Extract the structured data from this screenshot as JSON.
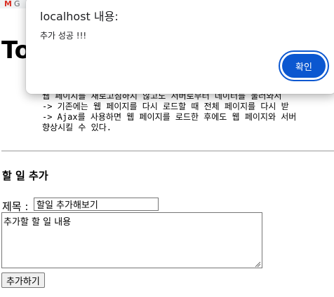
{
  "browser": {
    "tab_label": "G"
  },
  "page": {
    "title_partial": "To",
    "lines": [
      "웹 페이지를 새로고침하지 않고도 서버로부터 데이터를 불러와서",
      "-> 기존에는 웹 페이지를 다시 로드할 때 전체 페이지를 다시 받",
      "-> Ajax를 사용하면 웹 페이지를 로드한 후에도 웹 페이지와 서버",
      "향상시킬 수 있다."
    ],
    "section_heading": "할 일 추가",
    "form": {
      "title_label": "제목 :",
      "title_value": "할일 추가해보기",
      "content_value": "추가할 할 일 내용",
      "submit_label": "추가하기"
    }
  },
  "alert": {
    "title": "localhost 내용:",
    "message": "추가 성공 !!!",
    "ok_label": "확인"
  }
}
